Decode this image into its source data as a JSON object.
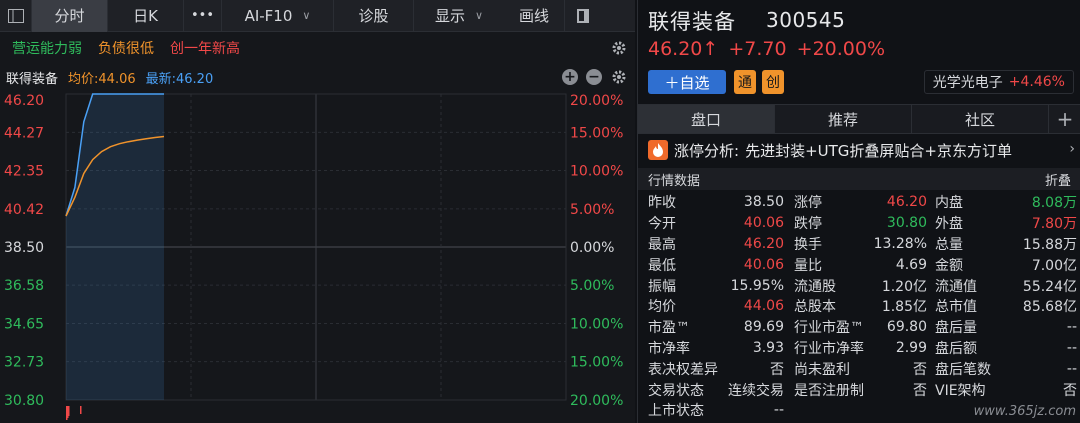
{
  "toolbar": {
    "timeshare": "分时",
    "daily": "日K",
    "more": "•••",
    "f10": "AI-F10",
    "diagnose": "诊股",
    "display": "显示",
    "draw": "画线"
  },
  "tags": [
    {
      "text": "营运能力弱",
      "tone": "green"
    },
    {
      "text": "负债很低",
      "tone": "orange"
    },
    {
      "text": "创一年新高",
      "tone": "red"
    }
  ],
  "legend": {
    "name": "联得装备",
    "avg": "均价:44.06",
    "last": "最新:46.20"
  },
  "chart_data": {
    "type": "line",
    "prev_close": 38.5,
    "ylim": [
      30.8,
      46.2
    ],
    "y_ticks": [
      46.2,
      44.27,
      42.35,
      40.42,
      38.5,
      36.58,
      34.65,
      32.73,
      30.8
    ],
    "y_ticks_pct": [
      "20.00%",
      "15.00%",
      "10.00%",
      "5.00%",
      "0.00%",
      "5.00%",
      "10.00%",
      "15.00%",
      "20.00%"
    ],
    "series": [
      {
        "values": [
          40.06,
          41.5,
          44.8,
          46.2,
          46.2,
          46.2,
          46.2,
          46.2,
          46.2,
          46.2,
          46.2,
          46.2
        ]
      },
      {
        "values": [
          40.06,
          41.0,
          42.2,
          42.9,
          43.3,
          43.55,
          43.7,
          43.8,
          43.88,
          43.95,
          44.01,
          44.06
        ]
      }
    ],
    "colors": {
      "price": "#4aa0f5",
      "avg": "#f0932b",
      "up": "#f04848",
      "down": "#2fbb5c",
      "flat": "#d6d8dc"
    }
  },
  "quote": {
    "name": "联得装备",
    "code": "300545",
    "price": "46.20↑",
    "change": "+7.70",
    "pct": "+20.00%",
    "fav": "＋自选",
    "tag_tong": "通",
    "tag_chuang": "创",
    "sector_name": "光学光电子",
    "sector_chg": "+4.46%"
  },
  "tabs": [
    "盘口",
    "推荐",
    "社区",
    "+"
  ],
  "news": {
    "label": "涨停分析:",
    "text": "先进封装+UTG折叠屏贴合+京东方订单"
  },
  "section": {
    "title": "行情数据",
    "collapse": "折叠"
  },
  "rows": [
    [
      [
        "昨收",
        "38.50",
        "flat"
      ],
      [
        "涨停",
        "46.20",
        "up"
      ],
      [
        "内盘",
        "8.08万",
        "down"
      ]
    ],
    [
      [
        "今开",
        "40.06",
        "up"
      ],
      [
        "跌停",
        "30.80",
        "down"
      ],
      [
        "外盘",
        "7.80万",
        "up"
      ]
    ],
    [
      [
        "最高",
        "46.20",
        "up"
      ],
      [
        "换手",
        "13.28%",
        "flat"
      ],
      [
        "总量",
        "15.88万",
        "flat"
      ]
    ],
    [
      [
        "最低",
        "40.06",
        "up"
      ],
      [
        "量比",
        "4.69",
        "flat"
      ],
      [
        "金额",
        "7.00亿",
        "flat"
      ]
    ],
    [
      [
        "振幅",
        "15.95%",
        "flat"
      ],
      [
        "流通股",
        "1.20亿",
        "flat"
      ],
      [
        "流通值",
        "55.24亿",
        "flat"
      ]
    ],
    [
      [
        "均价",
        "44.06",
        "up"
      ],
      [
        "总股本",
        "1.85亿",
        "flat"
      ],
      [
        "总市值",
        "85.68亿",
        "flat"
      ]
    ],
    [
      [
        "市盈™",
        "89.69",
        "flat"
      ],
      [
        "行业市盈™",
        "69.80",
        "flat"
      ],
      [
        "盘后量",
        "--",
        "flat"
      ]
    ],
    [
      [
        "市净率",
        "3.93",
        "flat"
      ],
      [
        "行业市净率",
        "2.99",
        "flat"
      ],
      [
        "盘后额",
        "--",
        "flat"
      ]
    ],
    [
      [
        "表决权差异",
        "否",
        "flat"
      ],
      [
        "尚未盈利",
        "否",
        "flat"
      ],
      [
        "盘后笔数",
        "--",
        "flat"
      ]
    ],
    [
      [
        "交易状态",
        "连续交易",
        "flat"
      ],
      [
        "是否注册制",
        "否",
        "flat"
      ],
      [
        "VIE架构",
        "否",
        "flat"
      ]
    ],
    [
      [
        "上市状态",
        "--",
        "flat"
      ],
      [
        "",
        "",
        ""
      ],
      [
        "",
        "",
        ""
      ]
    ]
  ],
  "watermark": "www.365jz.com"
}
